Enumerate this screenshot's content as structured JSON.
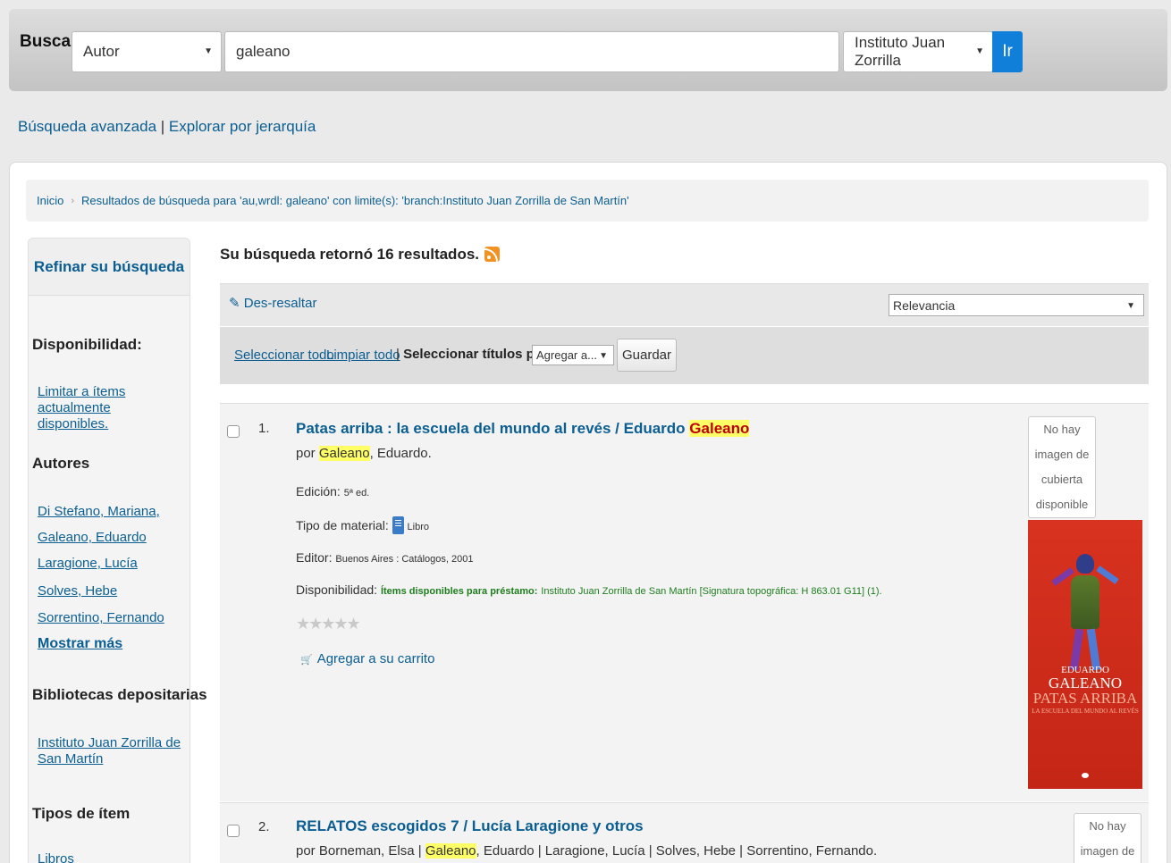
{
  "search": {
    "label": "Buscar",
    "index": "Autor",
    "query": "galeano",
    "branch": "Instituto Juan Zorrilla",
    "go": "Ir"
  },
  "toplinks": {
    "advanced": "Búsqueda avanzada",
    "separator": " | ",
    "browse": "Explorar por jerarquía"
  },
  "breadcrumb": {
    "home": "Inicio",
    "current": "Resultados de búsqueda para 'au,wrdl: galeano' con limite(s): 'branch:Instituto Juan Zorrilla de San Martín'"
  },
  "sidebar": {
    "title": "Refinar su búsqueda",
    "availability_head": "Disponibilidad:",
    "availability_link": "Limitar a ítems actualmente disponibles.",
    "authors_head": "Autores",
    "authors": [
      "Di Stefano, Mariana,",
      "Galeano, Eduardo",
      "Laragione, Lucía",
      "Solves, Hebe",
      "Sorrentino, Fernando"
    ],
    "show_more": "Mostrar más",
    "libraries_head": "Bibliotecas depositarias",
    "library": "Instituto Juan Zorrilla de San Martín",
    "itemtypes_head": "Tipos de ítem",
    "itemtype": "Libros"
  },
  "results": {
    "summary": "Su búsqueda retornó 16 resultados.",
    "unhighlight": "Des-resaltar",
    "sort": "Relevancia",
    "select_all": "Seleccionar todo",
    "clear_all": "Limpiar todo",
    "select_titles_sep": "| ",
    "select_titles": "Seleccionar títulos para:",
    "add_to": "Agregar a...",
    "save": "Guardar"
  },
  "records": [
    {
      "num": "1.",
      "title_pre": "Patas arriba : la escuela del mundo al revés / Eduardo ",
      "title_hl": "Galeano",
      "by_pre": "por ",
      "by_hl": "Galeano",
      "by_post": ", Eduardo.",
      "edition_label": "Edición:",
      "edition_value": "5ª ed.",
      "type_label": "Tipo de material:",
      "type_value": "Libro",
      "publisher_label": "Editor:",
      "publisher_value": "Buenos Aires : Catálogos, 2001",
      "avail_label": "Disponibilidad:",
      "avail_status": "Ítems disponibles para préstamo:",
      "avail_detail": "Instituto Juan Zorrilla de San Martín [Signatura topográfica: H 863.01 G11] (1).",
      "stars": "★★★★★",
      "cart": "Agregar a su carrito",
      "nocover": [
        "No hay",
        "imagen de",
        "cubierta",
        "disponible"
      ],
      "cover": {
        "author": "EDUARDO",
        "name": "GALEANO",
        "title": "PATAS ARRIBA",
        "subtitle": "LA ESCUELA DEL MUNDO AL REVÉS"
      }
    },
    {
      "num": "2.",
      "title": "RELATOS escogidos 7 / Lucía Laragione y otros",
      "by_pre": "por Borneman, Elsa | ",
      "by_hl": "Galeano",
      "by_post": ", Eduardo | Laragione, Lucía | Solves, Hebe | Sorrentino, Fernando.",
      "nocover": [
        "No hay",
        "imagen de"
      ]
    }
  ]
}
